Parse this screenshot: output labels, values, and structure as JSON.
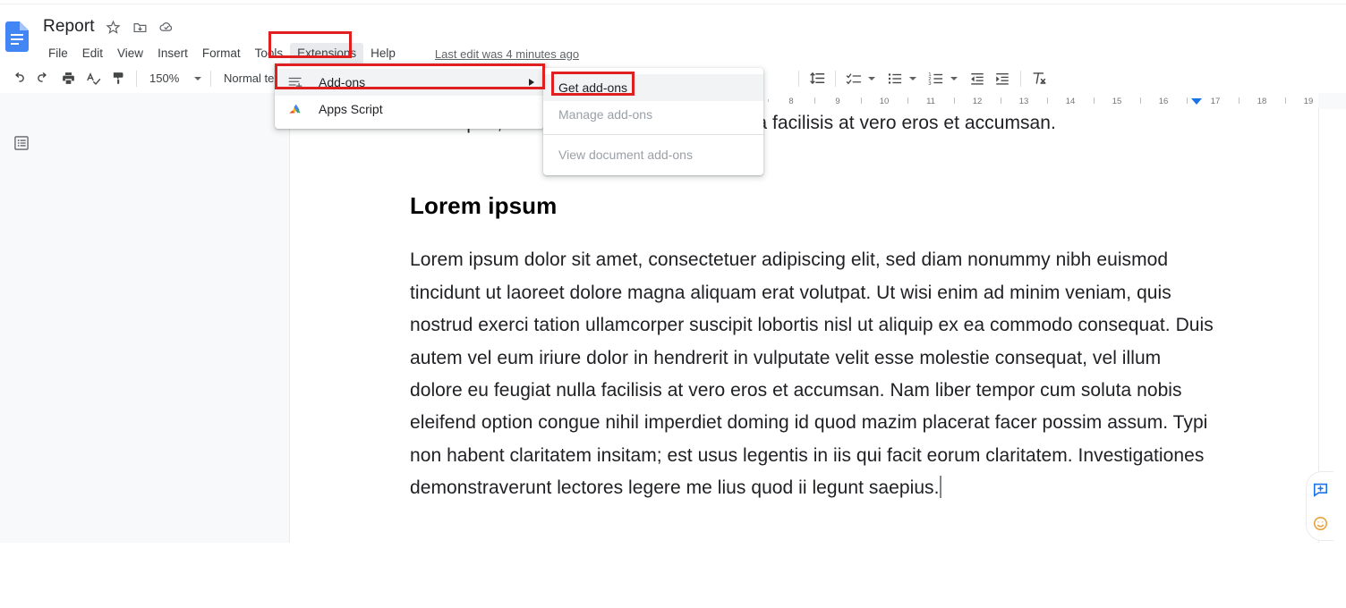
{
  "app": {
    "doc_title": "Report",
    "logo_name": "google-docs-logo"
  },
  "header": {
    "icons": [
      {
        "name": "star-icon",
        "glyph": "☆"
      },
      {
        "name": "move-to-folder-icon",
        "glyph": "▣"
      },
      {
        "name": "saved-to-drive-icon",
        "glyph": "☁"
      }
    ],
    "menus": [
      "File",
      "Edit",
      "View",
      "Insert",
      "Format",
      "Tools",
      "Extensions",
      "Help"
    ],
    "active_menu": "Extensions",
    "last_edit": "Last edit was 4 minutes ago"
  },
  "toolbar": {
    "undo": "undo-icon",
    "redo": "redo-icon",
    "print": "print-icon",
    "spelling": "spellcheck-icon",
    "paint_format": "paint-format-icon",
    "zoom_value": "150%",
    "style_value": "Normal text",
    "line_spacing": "line-spacing-icon",
    "checklist": "checklist-icon",
    "bulleted_list": "bulleted-list-icon",
    "numbered_list": "numbered-list-icon",
    "decrease_indent": "decrease-indent-icon",
    "increase_indent": "increase-indent-icon",
    "clear_formatting": "clear-formatting-icon"
  },
  "ruler": {
    "numbers": [
      "8",
      "9",
      "10",
      "11",
      "12",
      "13",
      "14",
      "15",
      "16",
      "17",
      "18",
      "19"
    ],
    "marker_name": "right-indent-marker"
  },
  "sidebar": {
    "outline_icon": "document-outline-icon"
  },
  "extensions_menu": {
    "items": [
      {
        "label": "Add-ons",
        "icon": "add-ons-icon",
        "has_submenu": true,
        "highlighted": true
      },
      {
        "label": "Apps Script",
        "icon": "apps-script-icon",
        "has_submenu": false,
        "highlighted": false
      }
    ]
  },
  "addons_submenu": {
    "items": [
      {
        "label": "Get add-ons",
        "disabled": false,
        "hovered": true
      },
      {
        "label": "Manage add-ons",
        "disabled": true,
        "hovered": false
      },
      {
        "label": "View document add-ons",
        "disabled": true,
        "hovered": false
      }
    ]
  },
  "document": {
    "partial_top_line": "consequat, vel illum dolore eu feugiat nulla facilisis at vero eros et accumsan.",
    "heading": "Lorem ipsum",
    "paragraph": "Lorem ipsum dolor sit amet, consectetuer adipiscing elit, sed diam nonummy nibh euismod tincidunt ut laoreet dolore magna aliquam erat volutpat. Ut wisi enim ad minim veniam, quis nostrud exerci tation ullamcorper suscipit lobortis nisl ut aliquip ex ea commodo consequat. Duis autem vel eum iriure dolor in hendrerit in vulputate velit esse molestie consequat, vel illum dolore eu feugiat nulla facilisis at vero eros et accumsan. Nam liber tempor cum soluta nobis eleifend option congue nihil imperdiet doming id quod mazim placerat facer possim assum. Typi non habent claritatem insitam; est usus legentis in iis qui facit eorum claritatem. Investigationes demonstraverunt lectores legere me lius quod ii legunt saepius."
  },
  "side_actions": {
    "items": [
      {
        "name": "add-comment-icon",
        "color": "#1a73e8"
      },
      {
        "name": "add-reaction-icon",
        "color": "#e8a33d"
      }
    ]
  },
  "annotations": {
    "highlight_color": "#e02020",
    "boxes": [
      {
        "name": "extensions-menu-highlight"
      },
      {
        "name": "add-ons-item-highlight"
      },
      {
        "name": "get-add-ons-item-highlight"
      }
    ]
  }
}
